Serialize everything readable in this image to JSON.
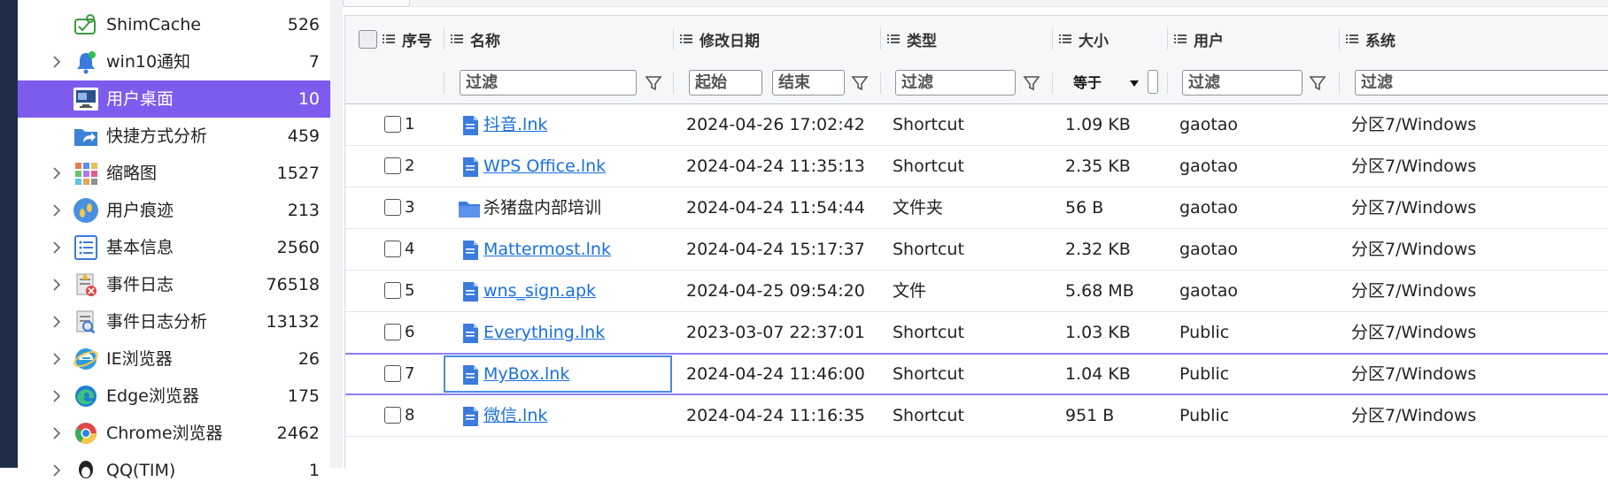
{
  "sidebar": {
    "items": [
      {
        "label": "ShimCache",
        "count": "526",
        "icon": "shimcache-icon",
        "expandable": false,
        "selected": false
      },
      {
        "label": "win10通知",
        "count": "7",
        "icon": "notification-bell-icon",
        "expandable": true,
        "selected": false
      },
      {
        "label": "用户桌面",
        "count": "10",
        "icon": "desktop-monitor-icon",
        "expandable": false,
        "selected": true
      },
      {
        "label": "快捷方式分析",
        "count": "459",
        "icon": "shortcut-folder-icon",
        "expandable": false,
        "selected": false
      },
      {
        "label": "缩略图",
        "count": "1527",
        "icon": "thumbnail-grid-icon",
        "expandable": true,
        "selected": false
      },
      {
        "label": "用户痕迹",
        "count": "213",
        "icon": "footprints-icon",
        "expandable": true,
        "selected": false
      },
      {
        "label": "基本信息",
        "count": "2560",
        "icon": "info-list-icon",
        "expandable": true,
        "selected": false
      },
      {
        "label": "事件日志",
        "count": "76518",
        "icon": "event-log-icon",
        "expandable": true,
        "selected": false
      },
      {
        "label": "事件日志分析",
        "count": "13132",
        "icon": "event-log-analysis-icon",
        "expandable": true,
        "selected": false
      },
      {
        "label": "IE浏览器",
        "count": "26",
        "icon": "ie-browser-icon",
        "expandable": true,
        "selected": false
      },
      {
        "label": "Edge浏览器",
        "count": "175",
        "icon": "edge-browser-icon",
        "expandable": true,
        "selected": false
      },
      {
        "label": "Chrome浏览器",
        "count": "2462",
        "icon": "chrome-browser-icon",
        "expandable": true,
        "selected": false
      },
      {
        "label": "QQ(TIM)",
        "count": "1",
        "icon": "qq-icon",
        "expandable": true,
        "selected": false
      }
    ]
  },
  "columns": {
    "index": "序号",
    "name": "名称",
    "modified": "修改日期",
    "type": "类型",
    "size": "大小",
    "user": "用户",
    "system": "系统"
  },
  "filters": {
    "name_placeholder": "过滤",
    "date_start_placeholder": "起始",
    "date_end_placeholder": "结束",
    "type_placeholder": "过滤",
    "size_operator": "等于",
    "user_placeholder": "过滤",
    "system_placeholder": "过滤"
  },
  "rows": [
    {
      "index": "1",
      "name": "抖音.lnk",
      "modified": "2024-04-26 17:02:42",
      "type": "Shortcut",
      "size": "1.09 KB",
      "user": "gaotao",
      "system": "分区7/Windows",
      "kind": "file"
    },
    {
      "index": "2",
      "name": "WPS Office.lnk",
      "modified": "2024-04-24 11:35:13",
      "type": "Shortcut",
      "size": "2.35 KB",
      "user": "gaotao",
      "system": "分区7/Windows",
      "kind": "file"
    },
    {
      "index": "3",
      "name": "杀猪盘内部培训",
      "modified": "2024-04-24 11:54:44",
      "type": "文件夹",
      "size": "56 B",
      "user": "gaotao",
      "system": "分区7/Windows",
      "kind": "folder"
    },
    {
      "index": "4",
      "name": "Mattermost.lnk",
      "modified": "2024-04-24 15:17:37",
      "type": "Shortcut",
      "size": "2.32 KB",
      "user": "gaotao",
      "system": "分区7/Windows",
      "kind": "file"
    },
    {
      "index": "5",
      "name": "wns_sign.apk",
      "modified": "2024-04-25 09:54:20",
      "type": "文件",
      "size": "5.68 MB",
      "user": "gaotao",
      "system": "分区7/Windows",
      "kind": "file"
    },
    {
      "index": "6",
      "name": "Everything.lnk",
      "modified": "2023-03-07 22:37:01",
      "type": "Shortcut",
      "size": "1.03 KB",
      "user": "Public",
      "system": "分区7/Windows",
      "kind": "file"
    },
    {
      "index": "7",
      "name": "MyBox.lnk",
      "modified": "2024-04-24 11:46:00",
      "type": "Shortcut",
      "size": "1.04 KB",
      "user": "Public",
      "system": "分区7/Windows",
      "kind": "file",
      "selected": true
    },
    {
      "index": "8",
      "name": "微信.lnk",
      "modified": "2024-04-24 11:16:35",
      "type": "Shortcut",
      "size": "951 B",
      "user": "Public",
      "system": "分区7/Windows",
      "kind": "file"
    }
  ],
  "colors": {
    "accent": "#7d5ced",
    "link": "#1a6fe0",
    "focus": "#4a8be5"
  }
}
